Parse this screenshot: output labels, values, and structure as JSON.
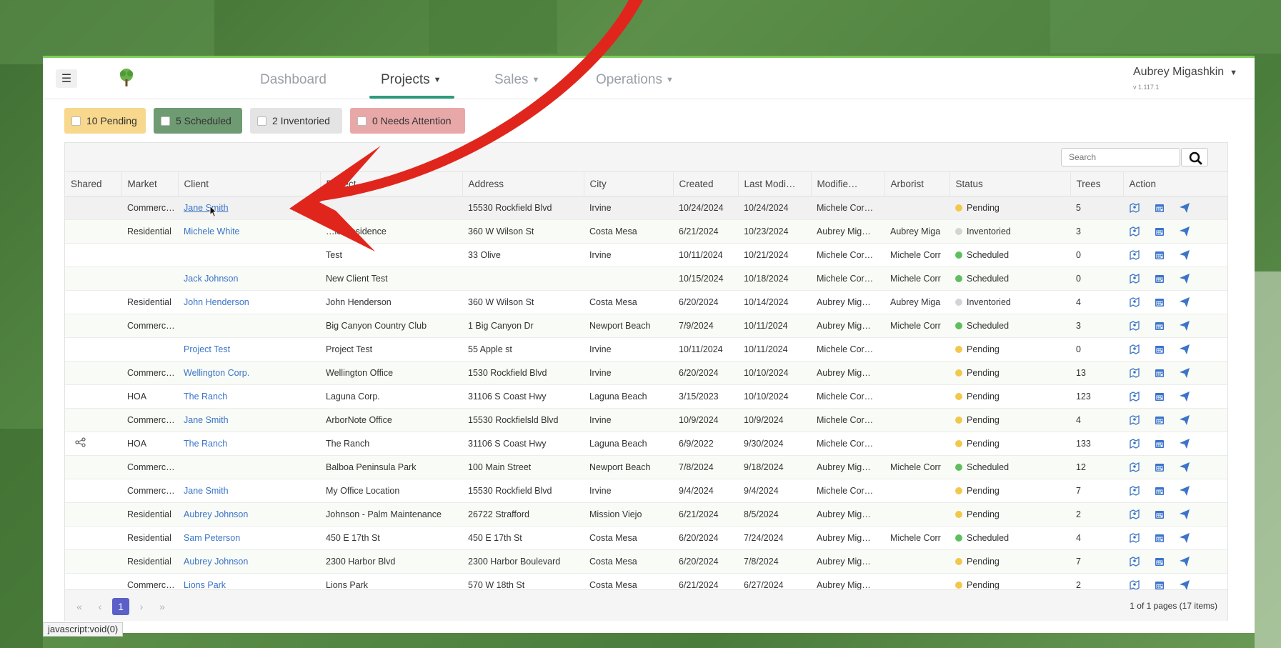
{
  "nav": {
    "menu_icon": "hamburger-icon",
    "logo_icon": "tree-logo-icon",
    "items": [
      {
        "label": "Dashboard"
      },
      {
        "label": "Projects"
      },
      {
        "label": "Sales"
      },
      {
        "label": "Operations"
      }
    ],
    "user_name": "Aubrey Migashkin",
    "version": "v 1.117.1"
  },
  "filters": [
    {
      "label": "10 Pending",
      "color": "#f7d88c"
    },
    {
      "label": "5 Scheduled",
      "color": "#6f9b72"
    },
    {
      "label": "2 Inventoried",
      "color": "#e4e4e4"
    },
    {
      "label": "0 Needs Attention",
      "color": "#e8a8a8"
    }
  ],
  "search": {
    "placeholder": "Search"
  },
  "columns": [
    "Shared",
    "Market",
    "Client",
    "Project",
    "Address",
    "City",
    "Created",
    "Last Modi…",
    "Modifie…",
    "Arborist",
    "Status",
    "Trees",
    "Action"
  ],
  "status_colors": {
    "Pending": "#f2c84b",
    "Inventoried": "#d4d4d4",
    "Scheduled": "#5fbf5f"
  },
  "rows": [
    {
      "shared": "",
      "market": "Commerc…",
      "client": "Jane Smith",
      "project": "",
      "address": "15530 Rockfield Blvd",
      "city": "Irvine",
      "created": "10/24/2024",
      "modified": "10/24/2024",
      "modified_by": "Michele Cor…",
      "arborist": "",
      "status": "Pending",
      "trees": "5"
    },
    {
      "shared": "",
      "market": "Residential",
      "client": "Michele White",
      "project": "…le Residence",
      "address": "360 W Wilson St",
      "city": "Costa Mesa",
      "created": "6/21/2024",
      "modified": "10/23/2024",
      "modified_by": "Aubrey Mig…",
      "arborist": "Aubrey Miga",
      "status": "Inventoried",
      "trees": "3"
    },
    {
      "shared": "",
      "market": "",
      "client": "",
      "project": "Test",
      "address": "33 Olive",
      "city": "Irvine",
      "created": "10/11/2024",
      "modified": "10/21/2024",
      "modified_by": "Michele Cor…",
      "arborist": "Michele Corr",
      "status": "Scheduled",
      "trees": "0"
    },
    {
      "shared": "",
      "market": "",
      "client": "Jack Johnson",
      "project": "New Client Test",
      "address": "",
      "city": "",
      "created": "10/15/2024",
      "modified": "10/18/2024",
      "modified_by": "Michele Cor…",
      "arborist": "Michele Corr",
      "status": "Scheduled",
      "trees": "0"
    },
    {
      "shared": "",
      "market": "Residential",
      "client": "John Henderson",
      "project": "John Henderson",
      "address": "360 W Wilson St",
      "city": "Costa Mesa",
      "created": "6/20/2024",
      "modified": "10/14/2024",
      "modified_by": "Aubrey Mig…",
      "arborist": "Aubrey Miga",
      "status": "Inventoried",
      "trees": "4"
    },
    {
      "shared": "",
      "market": "Commerc…",
      "client": "",
      "project": "Big Canyon Country Club",
      "address": "1 Big Canyon Dr",
      "city": "Newport Beach",
      "created": "7/9/2024",
      "modified": "10/11/2024",
      "modified_by": "Aubrey Mig…",
      "arborist": "Michele Corr",
      "status": "Scheduled",
      "trees": "3"
    },
    {
      "shared": "",
      "market": "",
      "client": "Project Test",
      "project": "Project Test",
      "address": "55 Apple st",
      "city": "Irvine",
      "created": "10/11/2024",
      "modified": "10/11/2024",
      "modified_by": "Michele Cor…",
      "arborist": "",
      "status": "Pending",
      "trees": "0"
    },
    {
      "shared": "",
      "market": "Commerc…",
      "client": "Wellington Corp.",
      "project": "Wellington Office",
      "address": "1530 Rockfield Blvd",
      "city": "Irvine",
      "created": "6/20/2024",
      "modified": "10/10/2024",
      "modified_by": "Aubrey Mig…",
      "arborist": "",
      "status": "Pending",
      "trees": "13"
    },
    {
      "shared": "",
      "market": "HOA",
      "client": "The Ranch",
      "project": "Laguna Corp.",
      "address": "31106 S Coast Hwy",
      "city": "Laguna Beach",
      "created": "3/15/2023",
      "modified": "10/10/2024",
      "modified_by": "Michele Cor…",
      "arborist": "",
      "status": "Pending",
      "trees": "123"
    },
    {
      "shared": "",
      "market": "Commerc…",
      "client": "Jane Smith",
      "project": "ArborNote Office",
      "address": "15530 Rockfielsld Blvd",
      "city": "Irvine",
      "created": "10/9/2024",
      "modified": "10/9/2024",
      "modified_by": "Michele Cor…",
      "arborist": "",
      "status": "Pending",
      "trees": "4"
    },
    {
      "shared": "share",
      "market": "HOA",
      "client": "The Ranch",
      "project": "The Ranch",
      "address": "31106 S Coast Hwy",
      "city": "Laguna Beach",
      "created": "6/9/2022",
      "modified": "9/30/2024",
      "modified_by": "Michele Cor…",
      "arborist": "",
      "status": "Pending",
      "trees": "133"
    },
    {
      "shared": "",
      "market": "Commerc…",
      "client": "",
      "project": "Balboa Peninsula Park",
      "address": "100 Main Street",
      "city": "Newport Beach",
      "created": "7/8/2024",
      "modified": "9/18/2024",
      "modified_by": "Aubrey Mig…",
      "arborist": "Michele Corr",
      "status": "Scheduled",
      "trees": "12"
    },
    {
      "shared": "",
      "market": "Commerc…",
      "client": "Jane Smith",
      "project": "My Office Location",
      "address": "15530 Rockfield Blvd",
      "city": "Irvine",
      "created": "9/4/2024",
      "modified": "9/4/2024",
      "modified_by": "Michele Cor…",
      "arborist": "",
      "status": "Pending",
      "trees": "7"
    },
    {
      "shared": "",
      "market": "Residential",
      "client": "Aubrey Johnson",
      "project": "Johnson - Palm Maintenance",
      "address": "26722 Strafford",
      "city": "Mission Viejo",
      "created": "6/21/2024",
      "modified": "8/5/2024",
      "modified_by": "Aubrey Mig…",
      "arborist": "",
      "status": "Pending",
      "trees": "2"
    },
    {
      "shared": "",
      "market": "Residential",
      "client": "Sam Peterson",
      "project": "450 E 17th St",
      "address": "450 E 17th St",
      "city": "Costa Mesa",
      "created": "6/20/2024",
      "modified": "7/24/2024",
      "modified_by": "Aubrey Mig…",
      "arborist": "Michele Corr",
      "status": "Scheduled",
      "trees": "4"
    },
    {
      "shared": "",
      "market": "Residential",
      "client": "Aubrey Johnson",
      "project": "2300 Harbor Blvd",
      "address": "2300 Harbor Boulevard",
      "city": "Costa Mesa",
      "created": "6/20/2024",
      "modified": "7/8/2024",
      "modified_by": "Aubrey Mig…",
      "arborist": "",
      "status": "Pending",
      "trees": "7"
    },
    {
      "shared": "",
      "market": "Commerc…",
      "client": "Lions Park",
      "project": "Lions Park",
      "address": "570 W 18th St",
      "city": "Costa Mesa",
      "created": "6/21/2024",
      "modified": "6/27/2024",
      "modified_by": "Aubrey Mig…",
      "arborist": "",
      "status": "Pending",
      "trees": "2"
    }
  ],
  "action_icons": [
    "map-icon",
    "calendar-icon",
    "send-icon"
  ],
  "pager": {
    "first": "«",
    "prev": "‹",
    "current": "1",
    "next": "›",
    "last": "»",
    "info": "1 of 1 pages (17 items)"
  },
  "statusbar": "javascript:void(0)"
}
